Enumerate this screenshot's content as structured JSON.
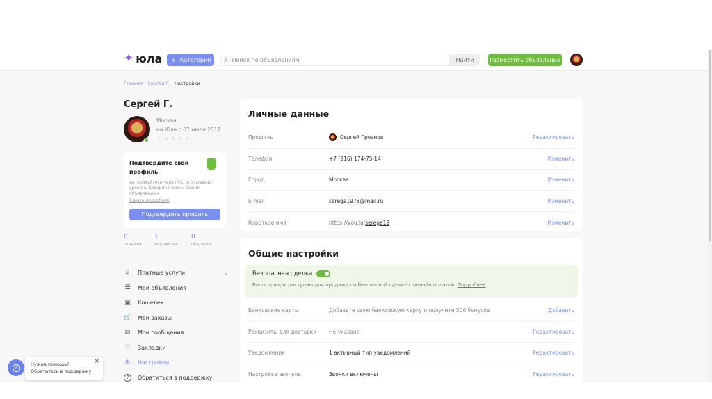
{
  "header": {
    "logo": "юла",
    "categories": "Категории",
    "search_placeholder": "Поиск по объявлениям",
    "find": "Найти",
    "post_ad": "Разместить объявление"
  },
  "breadcrumb": {
    "home": "Главная",
    "user": "Сергей Г.",
    "current": "Настройки",
    "sep": "·"
  },
  "profile": {
    "name": "Сергей Г.",
    "city": "Москва",
    "since": "на Юле с 07 июля 2017",
    "stars": "★★★★★"
  },
  "verify": {
    "title": "Подтвердите свой профиль",
    "text": "Авторизуйтесь через VK, это повысит уровень доверия к вам и вашим объявлениям",
    "link": "Узнать подробнее",
    "button": "Подтвердить профиль"
  },
  "stats": [
    {
      "n": "0",
      "l": "отзывов"
    },
    {
      "n": "1",
      "l": "подписчик"
    },
    {
      "n": "0",
      "l": "подписок"
    }
  ],
  "menu": [
    {
      "icon": "₽",
      "label": "Платные услуги"
    },
    {
      "icon": "☰",
      "label": "Мои объявления"
    },
    {
      "icon": "▣",
      "label": "Кошелек"
    },
    {
      "icon": "🛒",
      "label": "Мои заказы"
    },
    {
      "icon": "✉",
      "label": "Мои сообщения"
    },
    {
      "icon": "♡",
      "label": "Закладки"
    },
    {
      "icon": "⚙",
      "label": "Настройки"
    },
    {
      "icon": "?",
      "label": "Обратиться в поддержку"
    }
  ],
  "personal": {
    "title": "Личные данные",
    "rows": [
      {
        "label": "Профиль",
        "value": "Сергей Грознов",
        "action": "Редактировать"
      },
      {
        "label": "Телефон",
        "value": "+7 (916) 174-75-14",
        "action": "Изменить"
      },
      {
        "label": "Город",
        "value": "Москва",
        "action": "Изменить"
      },
      {
        "label": "E-mail",
        "value": "serega1978@mail.ru",
        "action": "Изменить"
      },
      {
        "label": "Короткое имя",
        "value_prefix": "https://you.la/",
        "value_link": "serega19",
        "action": "Изменить"
      }
    ]
  },
  "general": {
    "title": "Общие настройки",
    "safe_title": "Безопасная сделка",
    "safe_enabled": true,
    "safe_text": "Ваши товары доступны для продажи по безопасной сделке с онлайн оплатой.",
    "safe_link": "Подробнее",
    "rows": [
      {
        "label": "Банковские карты",
        "value": "Добавьте свою банковскую карту и получите 300 бонусов",
        "action": "Добавить"
      },
      {
        "label": "Реквизиты для доставки",
        "value": "Не указано",
        "action": "Редактировать"
      },
      {
        "label": "Уведомления",
        "value": "1 активный тип уведомлений",
        "action": "Редактировать"
      },
      {
        "label": "Настройка звонков",
        "value": "Звонки включены",
        "action": "Редактировать"
      }
    ]
  },
  "help": {
    "line1": "Нужна помощь?",
    "line2": "Обратитесь в поддержку",
    "close": "×"
  },
  "colors": {
    "accent": "#7b8ff0",
    "green": "#6fbd3e"
  }
}
